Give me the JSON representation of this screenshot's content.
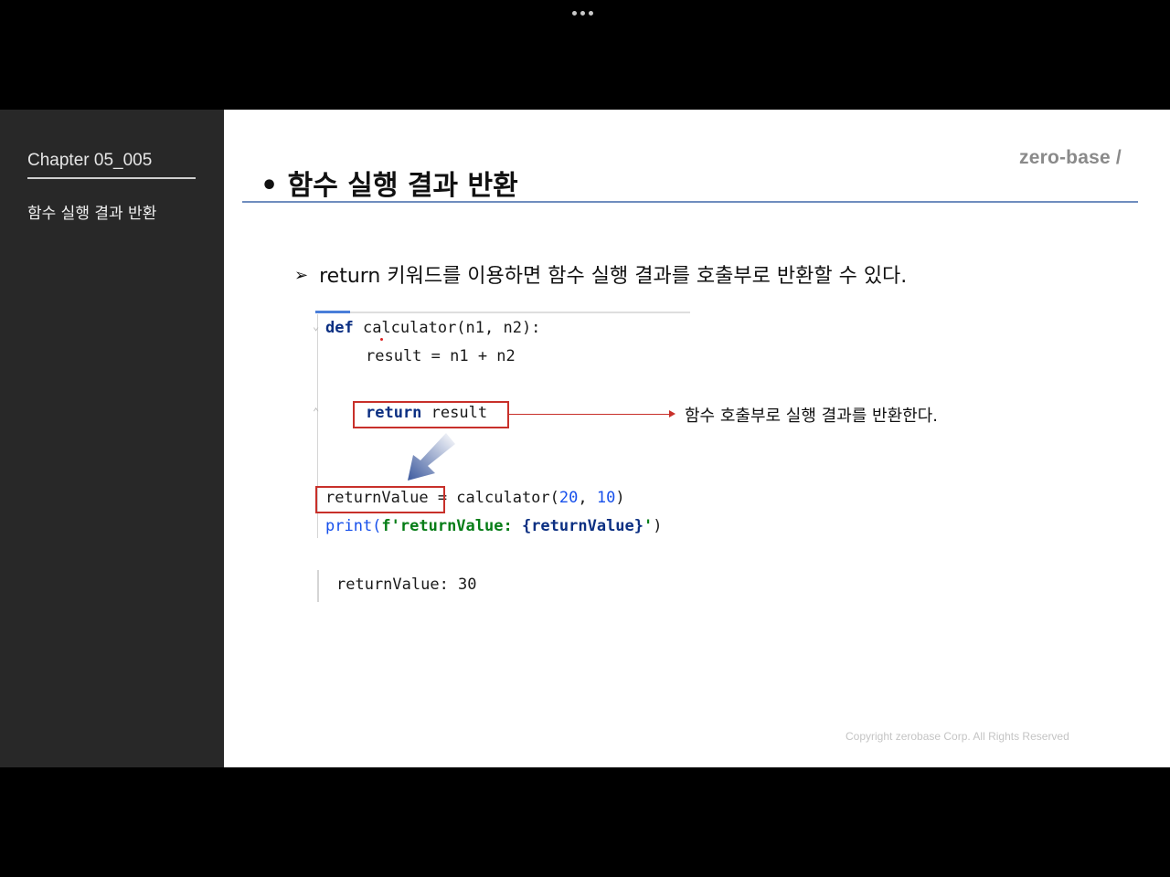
{
  "sidebar": {
    "chapter": "Chapter 05_005",
    "subtitle": "함수 실행 결과 반환"
  },
  "slide": {
    "title": "• 함수 실행 결과 반환",
    "brand": "zero-base /",
    "bullet_arrow": "➢",
    "bullet_text": "return 키워드를 이용하면 함수 실행 결과를 호출부로 반환할 수 있다.",
    "annotation": "함수 호출부로 실행 결과를 반환한다.",
    "copyright": "Copyright zerobase Corp. All Rights Reserved"
  },
  "code": {
    "line1_kw": "def",
    "line1_rest": " calculator(n1, n2):",
    "line2": "result = n1 + n2",
    "line3_kw": "return",
    "line3_rest": " result",
    "line4_var": "returnValue",
    "line4_mid": " = calculator(",
    "line4_arg1": "20",
    "line4_sep": ", ",
    "line4_arg2": "10",
    "line4_end": ")",
    "line5_fn": "print(",
    "line5_str1": "f'returnValue: ",
    "line5_expr": "{returnValue}",
    "line5_str2": "'",
    "line5_end": ")",
    "output": "returnValue: 30"
  },
  "colors": {
    "sidebar_bg": "#282828",
    "keyword": "#0b2f82",
    "number": "#1750eb",
    "string": "#067d17",
    "highlight_box": "#c8302a",
    "title_rule": "#6f8dbe"
  }
}
